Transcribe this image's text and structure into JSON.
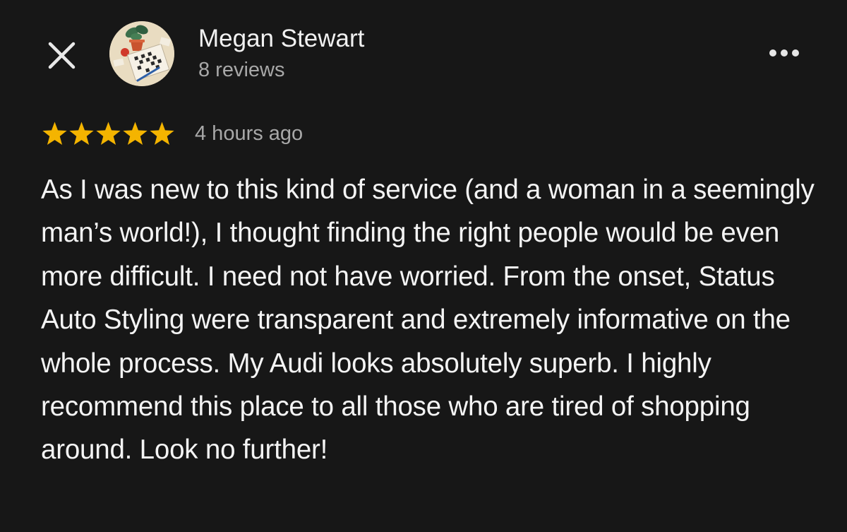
{
  "reviewer": {
    "name": "Megan Stewart",
    "review_count": "8 reviews",
    "avatar_icon": "crossword-puzzle-avatar"
  },
  "rating": {
    "stars": 5,
    "max_stars": 5,
    "star_color": "#f4b400",
    "time": "4 hours ago"
  },
  "review": {
    "text": "As I was new to this kind of service (and a woman in a seemingly man’s world!), I thought finding the right people would be even more difficult. I need not have worried. From the onset, Status Auto Styling were transparent and extremely informative on the whole process. My Audi looks absolutely superb. I highly recommend this place to all those who are tired of shopping around. Look no further!"
  },
  "icons": {
    "close": "close-icon",
    "more": "more-options-icon"
  },
  "colors": {
    "background": "#171717",
    "primary_text": "#f4f4f4",
    "secondary_text": "#a8a8a8"
  }
}
